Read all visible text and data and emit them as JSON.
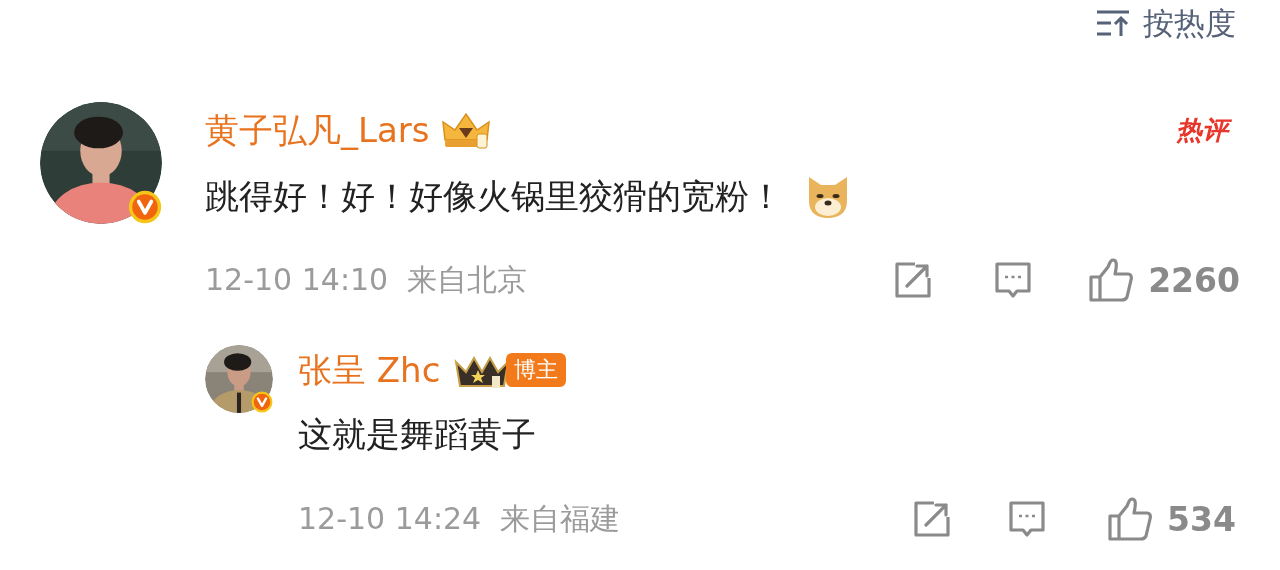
{
  "sort": {
    "label": "按热度"
  },
  "comments": [
    {
      "username": "黄子弘凡_Lars",
      "hot_label": "热评",
      "text": "跳得好！好！好像火锅里狡猾的宽粉！",
      "time": "12-10 14:10",
      "location": "来自北京",
      "likes": "2260",
      "verified": true,
      "replies": [
        {
          "username": "张呈 Zhc",
          "author_badge": "博主",
          "text": "这就是舞蹈黄子",
          "time": "12-10 14:24",
          "location": "来自福建",
          "likes": "534",
          "verified": true
        }
      ]
    }
  ]
}
